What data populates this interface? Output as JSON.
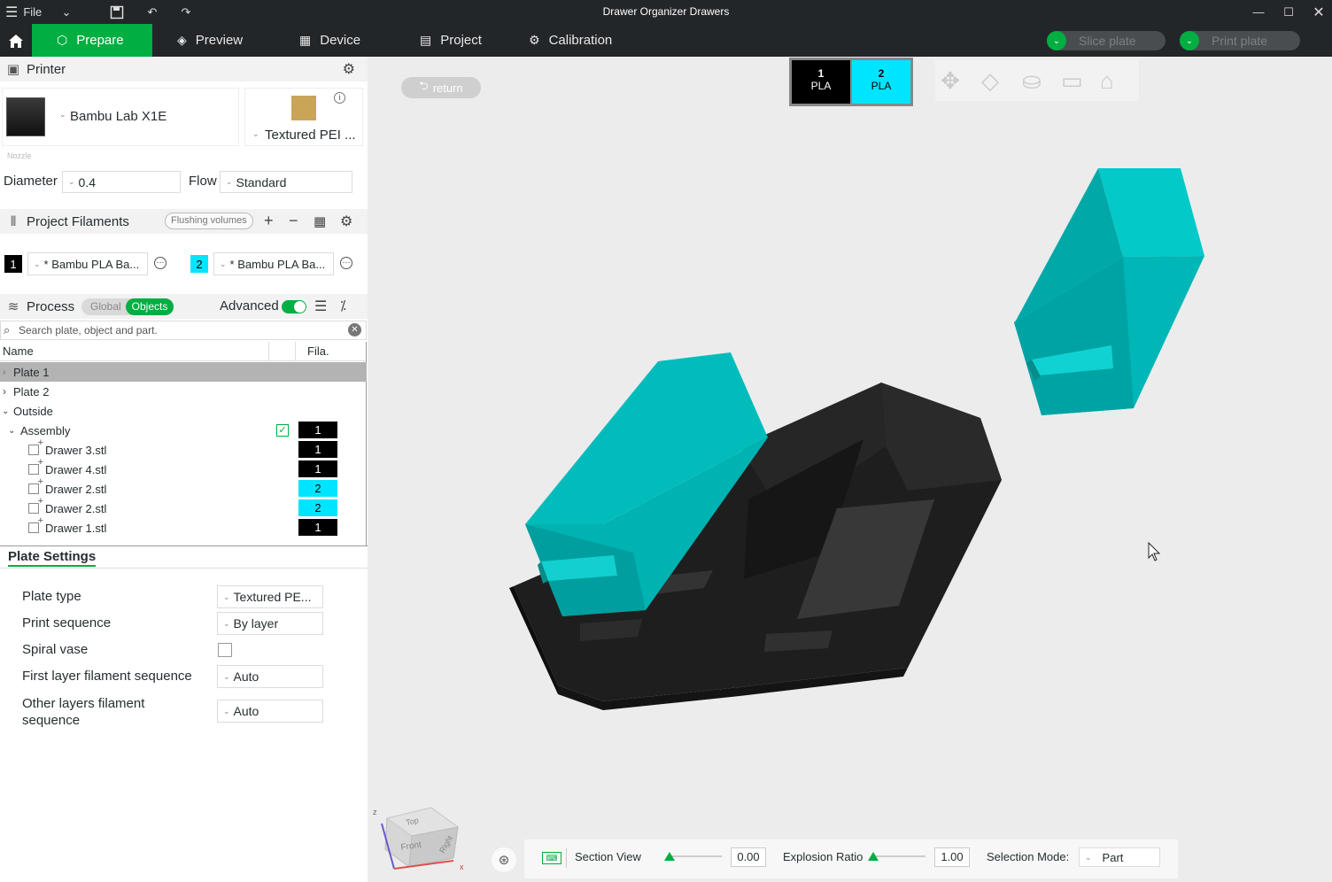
{
  "window": {
    "title": "Drawer Organizer Drawers",
    "file_menu": "File"
  },
  "tabs": [
    {
      "label": "Prepare"
    },
    {
      "label": "Preview"
    },
    {
      "label": "Device"
    },
    {
      "label": "Project"
    },
    {
      "label": "Calibration"
    }
  ],
  "actions": {
    "slice_plate": "Slice plate",
    "print_plate": "Print plate"
  },
  "printer": {
    "section_title": "Printer",
    "model": "Bambu Lab X1E",
    "plate": "Textured PEI ...",
    "nozzle_caption": "Nozzle",
    "diameter_label": "Diameter",
    "diameter_value": "0.4",
    "flow_label": "Flow",
    "flow_value": "Standard"
  },
  "filaments": {
    "section_title": "Project Filaments",
    "flushing_label": "Flushing volumes",
    "items": [
      {
        "index": "1",
        "name": "* Bambu PLA Ba...",
        "color": "#000000"
      },
      {
        "index": "2",
        "name": "* Bambu PLA Ba...",
        "color": "#00e5ff"
      }
    ]
  },
  "process": {
    "section_title": "Process",
    "global_label": "Global",
    "objects_label": "Objects",
    "advanced_label": "Advanced",
    "search_placeholder": "Search plate, object and part."
  },
  "object_list": {
    "col_name": "Name",
    "col_fila": "Fila.",
    "rows": [
      {
        "label": "Plate 1"
      },
      {
        "label": "Plate 2"
      },
      {
        "label": "Outside"
      },
      {
        "label": "Assembly",
        "fila": "1"
      },
      {
        "label": "Drawer 3.stl",
        "fila": "1"
      },
      {
        "label": "Drawer 4.stl",
        "fila": "1"
      },
      {
        "label": "Drawer 2.stl",
        "fila": "2"
      },
      {
        "label": "Drawer 2.stl",
        "fila": "2"
      },
      {
        "label": "Drawer 1.stl",
        "fila": "1"
      }
    ]
  },
  "plate_settings": {
    "title": "Plate Settings",
    "rows": [
      {
        "label": "Plate type",
        "value": "Textured PE..."
      },
      {
        "label": "Print sequence",
        "value": "By layer"
      },
      {
        "label": "Spiral vase",
        "value": ""
      },
      {
        "label": "First layer filament sequence",
        "value": "Auto"
      },
      {
        "label": "Other layers filament sequence",
        "value": "Auto"
      }
    ]
  },
  "viewport": {
    "return_label": "return",
    "filament_chips": [
      {
        "index": "1",
        "type": "PLA",
        "color": "#000000"
      },
      {
        "index": "2",
        "type": "PLA",
        "color": "#00e5ff"
      }
    ],
    "cube_faces": {
      "top": "Top",
      "front": "Front",
      "right": "Right"
    },
    "axes": {
      "x": "x",
      "z": "z"
    },
    "section_view_label": "Section View",
    "section_view_value": "0.00",
    "explosion_label": "Explosion Ratio",
    "explosion_value": "1.00",
    "selection_label": "Selection Mode:",
    "selection_value": "Part"
  },
  "colors": {
    "accent": "#00ae42",
    "topbar": "#232629",
    "cyan": "#00b3b3",
    "dark": "#1a1a1a"
  }
}
